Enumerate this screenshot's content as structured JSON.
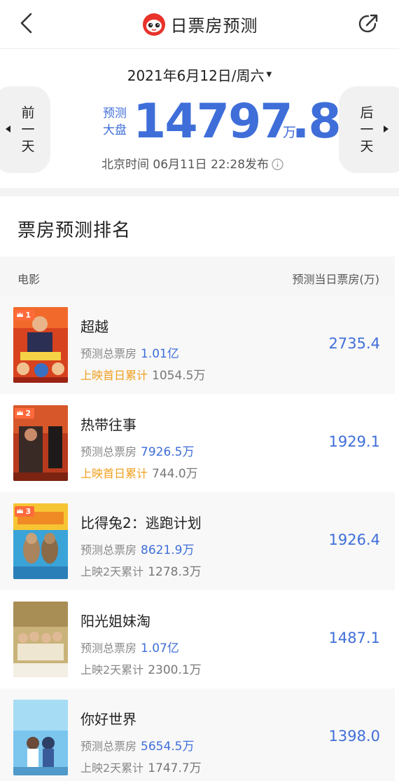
{
  "header": {
    "title": "日票房预测"
  },
  "summary": {
    "date": "2021年6月12日/周六",
    "prev_label": [
      "前",
      "一",
      "天"
    ],
    "next_label": [
      "后",
      "一",
      "天"
    ],
    "pred_label": [
      "预测",
      "大盘"
    ],
    "pred_value": "14797.8",
    "pred_unit": "万",
    "release_time": "北京时间 06月11日 22:28发布"
  },
  "ranking": {
    "title": "票房预测排名",
    "col_movie": "电影",
    "col_today": "预测当日票房(万)",
    "rows": [
      {
        "rank": "1",
        "name": "超越",
        "total_label": "预测总票房",
        "total": "1.01亿",
        "cum_label": "上映首日累计",
        "cum": "1054.5万",
        "today": "2735.4",
        "highlight": true
      },
      {
        "rank": "2",
        "name": "热带往事",
        "total_label": "预测总票房",
        "total": "7926.5万",
        "cum_label": "上映首日累计",
        "cum": "744.0万",
        "today": "1929.1",
        "highlight": true
      },
      {
        "rank": "3",
        "name": "比得兔2：逃跑计划",
        "total_label": "预测总票房",
        "total": "8621.9万",
        "cum_label": "上映2天累计",
        "cum": "1278.3万",
        "today": "1926.4",
        "highlight": false
      },
      {
        "rank": "",
        "name": "阳光姐妹淘",
        "total_label": "预测总票房",
        "total": "1.07亿",
        "cum_label": "上映2天累计",
        "cum": "2300.1万",
        "today": "1487.1",
        "highlight": false
      },
      {
        "rank": "",
        "name": "你好世界",
        "total_label": "预测总票房",
        "total": "5654.5万",
        "cum_label": "上映2天累计",
        "cum": "1747.7万",
        "today": "1398.0",
        "highlight": false
      }
    ]
  },
  "colors": {
    "accent_blue": "#3f6ed9",
    "first_day_orange": "#f0a020",
    "rank_badge": "#ff6a3c",
    "logo_red": "#e8322a"
  },
  "icons": {
    "back": "chevron-left-icon",
    "share": "share-arrow-icon",
    "logo": "cat-eye-logo-icon",
    "info": "info-circle-icon",
    "prev": "triangle-left-icon",
    "next": "triangle-right-icon",
    "caret": "caret-down-icon",
    "crown": "crown-icon"
  }
}
